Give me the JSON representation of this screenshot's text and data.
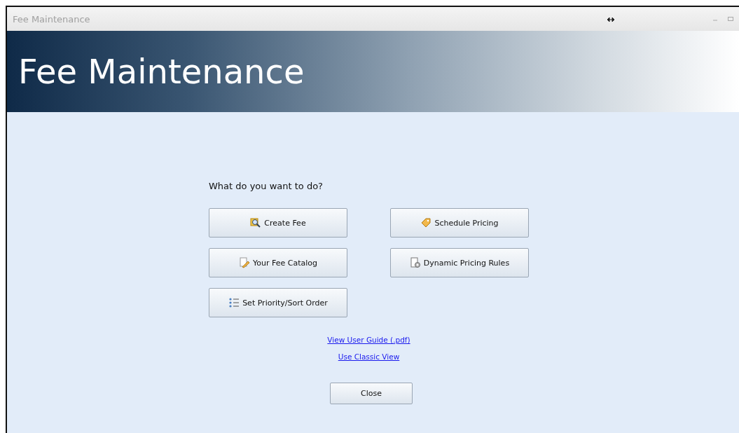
{
  "window": {
    "title": "Fee Maintenance"
  },
  "banner": {
    "title": "Fee Maintenance"
  },
  "prompt": "What do you want to do?",
  "actions": [
    {
      "label": "Create Fee"
    },
    {
      "label": "Schedule Pricing"
    },
    {
      "label": "Your Fee Catalog"
    },
    {
      "label": "Dynamic Pricing Rules"
    },
    {
      "label": "Set Priority/Sort Order"
    }
  ],
  "links": [
    "View User Guide (.pdf)",
    "Use Classic View"
  ],
  "close_button": "Close"
}
